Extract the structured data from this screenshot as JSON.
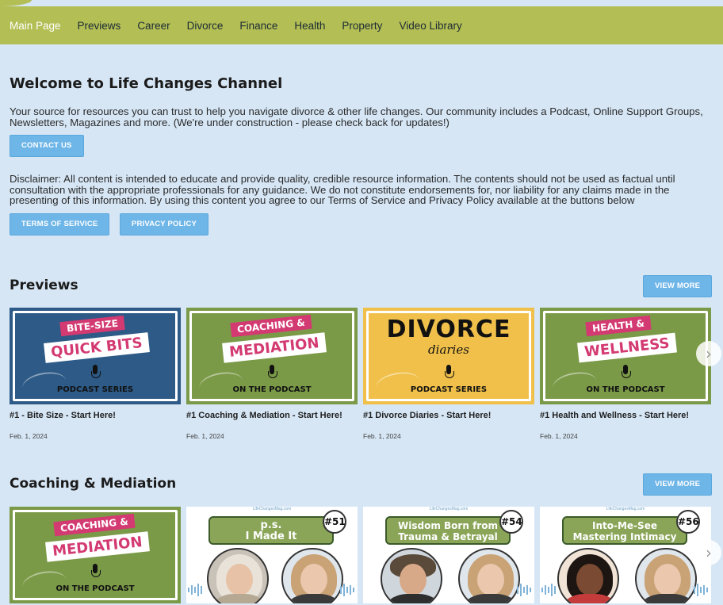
{
  "nav": {
    "items": [
      {
        "label": "Main Page",
        "active": true
      },
      {
        "label": "Previews"
      },
      {
        "label": "Career"
      },
      {
        "label": "Divorce"
      },
      {
        "label": "Finance"
      },
      {
        "label": "Health"
      },
      {
        "label": "Property"
      },
      {
        "label": "Video Library"
      }
    ]
  },
  "welcome": {
    "title": "Welcome to Life Changes Channel",
    "intro": "Your source for resources you can trust to help you navigate divorce & other life changes. Our community includes a Podcast, Online Support Groups, Newsletters, Magazines and more. (We're under construction - please check back for updates!)",
    "contact_label": "CONTACT US",
    "disclaimer": "Disclaimer: All content is intended to educate and provide quality, credible resource information. The contents should not be used as factual until consultation with the appropriate professionals for any guidance. We do not constitute endorsements for, nor liability for any claims made in the presenting of this information. By using this content you agree to our Terms of Service and Privacy Policy available at the buttons below",
    "terms_label": "TERMS OF SERVICE",
    "privacy_label": "PRIVACY POLICY"
  },
  "previews": {
    "title": "Previews",
    "view_more": "VIEW MORE",
    "cards": [
      {
        "title": "#1 - Bite Size - Start Here!",
        "date": "Feb. 1, 2024",
        "thumb": {
          "line1": "BITE-SIZE",
          "line2": "QUICK BITS",
          "footer": "PODCAST SERIES"
        }
      },
      {
        "title": "#1 Coaching & Mediation - Start Here!",
        "date": "Feb. 1, 2024",
        "thumb": {
          "line1": "COACHING &",
          "line2": "MEDIATION",
          "footer": "ON THE PODCAST"
        }
      },
      {
        "title": "#1 Divorce Diaries - Start Here!",
        "date": "Feb. 1, 2024",
        "thumb": {
          "line1": "DIVORCE",
          "line2": "diaries",
          "footer": "PODCAST SERIES"
        }
      },
      {
        "title": "#1 Health and Wellness - Start Here!",
        "date": "Feb. 1, 2024",
        "thumb": {
          "line1": "HEALTH &",
          "line2": "WELLNESS",
          "footer": "ON THE PODCAST"
        }
      }
    ]
  },
  "coaching": {
    "title": "Coaching & Mediation",
    "view_more": "VIEW MORE",
    "cards": [
      {
        "thumb": {
          "line1": "COACHING &",
          "line2": "MEDIATION",
          "footer": "ON THE PODCAST"
        }
      },
      {
        "thumb": {
          "site": "LifeChangesMag.com",
          "line1": "p.s.",
          "line2": "I Made It",
          "badge": "#51"
        }
      },
      {
        "thumb": {
          "site": "LifeChangesMag.com",
          "line1": "Wisdom Born from",
          "line2": "Trauma & Betrayal",
          "badge": "#54"
        }
      },
      {
        "thumb": {
          "site": "LifeChangesMag.com",
          "line1": "Into-Me-See",
          "line2": "Mastering Intimacy",
          "badge": "#56"
        }
      }
    ]
  },
  "colors": {
    "nav_bg": "#b3bf55",
    "page_bg": "#d6e6f5",
    "button": "#6fb6e8",
    "brand_pink": "#d33a72",
    "podcast_green": "#7b9a48"
  }
}
